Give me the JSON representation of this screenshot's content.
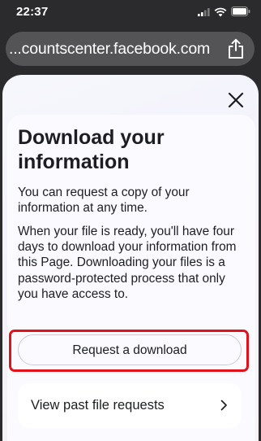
{
  "status_bar": {
    "time": "22:37",
    "icons": [
      "cellular-signal-icon",
      "wifi-icon",
      "battery-icon"
    ]
  },
  "browser": {
    "url": "...countscenter.facebook.com",
    "share_icon": "share-icon"
  },
  "sheet": {
    "close_icon": "close-icon",
    "title": "Download your information",
    "paragraph_1": "You can request a copy of your information at any time.",
    "paragraph_2": "When your file is ready, you'll have four days to download your information from this Page. Downloading your files is a password-protected process that only you have access to.",
    "request_button_label": "Request a download",
    "past_requests_label": "View past file requests",
    "chevron_icon": "chevron-right-icon"
  },
  "colors": {
    "highlight_border": "#e2121c",
    "text": "#1c1e21",
    "url_bar": "#545457"
  }
}
